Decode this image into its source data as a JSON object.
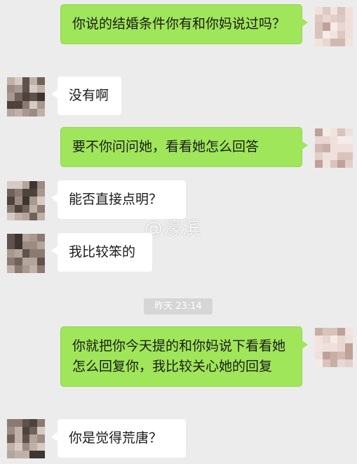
{
  "messages": {
    "m1": "你说的结婚条件你有和你妈说过吗？",
    "m2": "没有啊",
    "m3": "要不你问问她，看看她怎么回答",
    "m4": "能否直接点明？",
    "m5": "我比较笨的",
    "m6": "你就把你今天提的和你妈说下看看她怎么回复你，我比较关心她的回复",
    "m7": "你是觉得荒唐？"
  },
  "timestamp": "昨天 23:14",
  "watermark": "@濠滨",
  "colors": {
    "outgoing_bubble": "#9fe65a",
    "incoming_bubble": "#ffffff",
    "background": "#ececec"
  },
  "icons": {
    "self_avatar": "pixelated-avatar",
    "contact_avatar": "pixelated-avatar"
  }
}
